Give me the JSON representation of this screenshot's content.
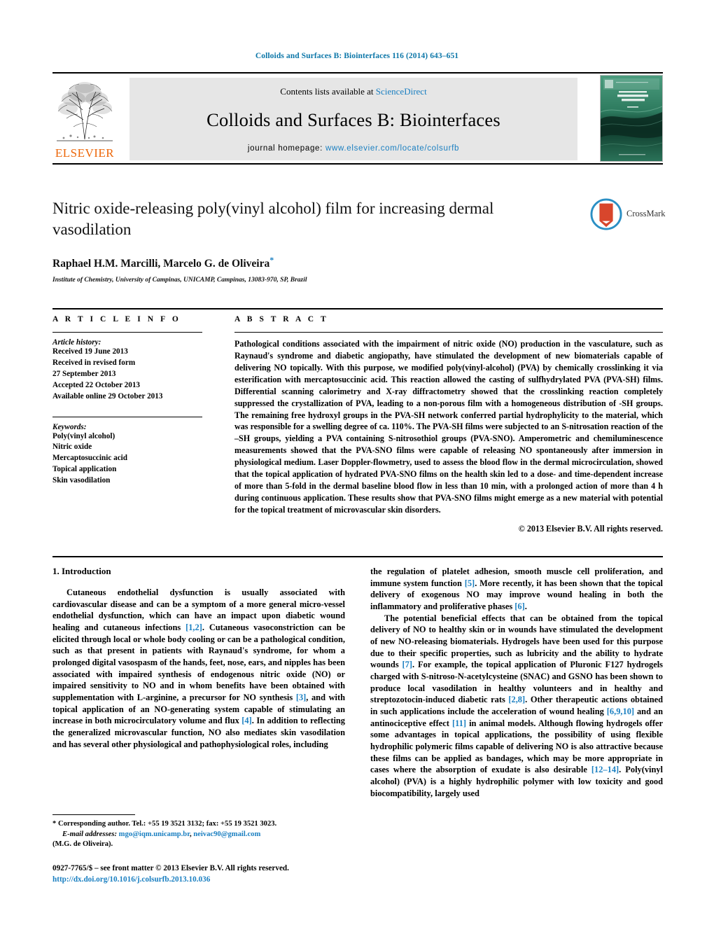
{
  "running_head": "Colloids and Surfaces B: Biointerfaces 116 (2014) 643–651",
  "masthead": {
    "contents_prefix": "Contents lists available at ",
    "sciencedirect": "ScienceDirect",
    "journal_title": "Colloids and Surfaces B: Biointerfaces",
    "homepage_label": "journal homepage:",
    "homepage_url": "www.elsevier.com/locate/colsurfb",
    "publisher_wordmark": "ELSEVIER",
    "publisher_logo_icon": "elsevier-tree-icon",
    "cover_thumb_icon": "journal-cover-thumbnail",
    "cover_title_line1": "COLLOIDS AND",
    "cover_title_line2": "SURFACES B",
    "accent_link_color": "#1a7fc1",
    "elsevier_orange": "#ec6608"
  },
  "article": {
    "title": "Nitric oxide-releasing poly(vinyl alcohol) film for increasing dermal vasodilation",
    "authors": "Raphael H.M. Marcilli, Marcelo G. de Oliveira",
    "corresponding_marker": "*",
    "affiliation": "Institute of Chemistry, University of Campinas, UNICAMP, Campinas, 13083-970, SP, Brazil",
    "crossmark_label": "CrossMark",
    "crossmark_icon": "crossmark-icon"
  },
  "article_info": {
    "heading": "A R T I C L E   I N F O",
    "history_label": "Article history:",
    "history": [
      "Received 19 June 2013",
      "Received in revised form",
      "27 September 2013",
      "Accepted 22 October 2013",
      "Available online 29 October 2013"
    ],
    "keywords_label": "Keywords:",
    "keywords": [
      "Poly(vinyl alcohol)",
      "Nitric oxide",
      "Mercaptosuccinic acid",
      "Topical application",
      "Skin vasodilation"
    ]
  },
  "abstract": {
    "heading": "A B S T R A C T",
    "text": "Pathological conditions associated with the impairment of nitric oxide (NO) production in the vasculature, such as Raynaud's syndrome and diabetic angiopathy, have stimulated the development of new biomaterials capable of delivering NO topically. With this purpose, we modified poly(vinyl-alcohol) (PVA) by chemically crosslinking it via esterification with mercaptosuccinic acid. This reaction allowed the casting of sulfhydrylated PVA (PVA-SH) films. Differential scanning calorimetry and X-ray diffractometry showed that the crosslinking reaction completely suppressed the crystallization of PVA, leading to a non-porous film with a homogeneous distribution of -SH groups. The remaining free hydroxyl groups in the PVA-SH network conferred partial hydrophylicity to the material, which was responsible for a swelling degree of ca. 110%. The PVA-SH films were subjected to an S-nitrosation reaction of the –SH groups, yielding a PVA containing S-nitrosothiol groups (PVA-SNO). Amperometric and chemiluminescence measurements showed that the PVA-SNO films were capable of releasing NO spontaneously after immersion in physiological medium. Laser Doppler-flowmetry, used to assess the blood flow in the dermal microcirculation, showed that the topical application of hydrated PVA-SNO films on the health skin led to a dose- and time-dependent increase of more than 5-fold in the dermal baseline blood flow in less than 10 min, with a prolonged action of more than 4 h during continuous application. These results show that PVA-SNO films might emerge as a new material with potential for the topical treatment of microvascular skin disorders.",
    "copyright": "© 2013 Elsevier B.V. All rights reserved."
  },
  "introduction": {
    "section_number_title": "1.  Introduction",
    "left_para1_a": "Cutaneous endothelial dysfunction is usually associated with cardiovascular disease and can be a symptom of a more general micro-vessel endothelial dysfunction, which can have an impact upon diabetic wound healing and cutaneous infections ",
    "left_ref1": "[1,2]",
    "left_para1_b": ". Cutaneous vasoconstriction can be elicited through local or whole body cooling or can be a pathological condition, such as that present in patients with Raynaud's syndrome, for whom a prolonged digital vasospasm of the hands, feet, nose, ears, and nipples has been associated with impaired synthesis of endogenous nitric oxide (NO) or impaired sensitivity to NO and in whom benefits have been obtained with supplementation with L-arginine, a precursor for NO synthesis ",
    "left_ref2": "[3]",
    "left_para1_c": ", and with topical application of an NO-generating system capable of stimulating an increase in both microcirculatory volume and flux ",
    "left_ref3": "[4]",
    "left_para1_d": ". In addition to reflecting the generalized microvascular function, NO also mediates skin vasodilation and has several other physiological and pathophysiological roles, including",
    "right_cont_a": "the regulation of platelet adhesion, smooth muscle cell proliferation, and immune system function ",
    "right_ref5": "[5]",
    "right_cont_b": ". More recently, it has been shown that the topical delivery of exogenous NO may improve wound healing in both the inflammatory and proliferative phases ",
    "right_ref6": "[6]",
    "right_cont_c": ".",
    "right_para2_a": "The potential beneficial effects that can be obtained from the topical delivery of NO to healthy skin or in wounds have stimulated the development of new NO-releasing biomaterials. Hydrogels have been used for this purpose due to their specific properties, such as lubricity and the ability to hydrate wounds ",
    "right_ref7": "[7]",
    "right_para2_b": ". For example, the topical application of Pluronic F127 hydrogels charged with S-nitroso-N-acetylcysteine (SNAC) and GSNO has been shown to produce local vasodilation in healthy volunteers and in healthy and streptozotocin-induced diabetic rats ",
    "right_ref28": "[2,8]",
    "right_para2_c": ". Other therapeutic actions obtained in such applications include the acceleration of wound healing ",
    "right_ref6910": "[6,9,10]",
    "right_para2_d": " and an antinociceptive effect ",
    "right_ref11": "[11]",
    "right_para2_e": " in animal models. Although flowing hydrogels offer some advantages in topical applications, the possibility of using flexible hydrophilic polymeric films capable of delivering NO is also attractive because these films can be applied as bandages, which may be more appropriate in cases where the absorption of exudate is also desirable ",
    "right_ref1214": "[12–14]",
    "right_para2_f": ". Poly(vinyl alcohol) (PVA) is a highly hydrophilic polymer with low toxicity and good biocompatibility, largely used"
  },
  "footnotes": {
    "corresponding": "*  Corresponding author. Tel.: +55 19 3521 3132; fax: +55 19 3521 3023.",
    "email_label": "E-mail addresses:",
    "email1": "mgo@iqm.unicamp.br",
    "email_sep": ", ",
    "email2": "neivac90@gmail.com",
    "email_owner": "(M.G. de Oliveira).",
    "issn_line": "0927-7765/$ – see front matter © 2013 Elsevier B.V. All rights reserved.",
    "doi": "http://dx.doi.org/10.1016/j.colsurfb.2013.10.036"
  }
}
